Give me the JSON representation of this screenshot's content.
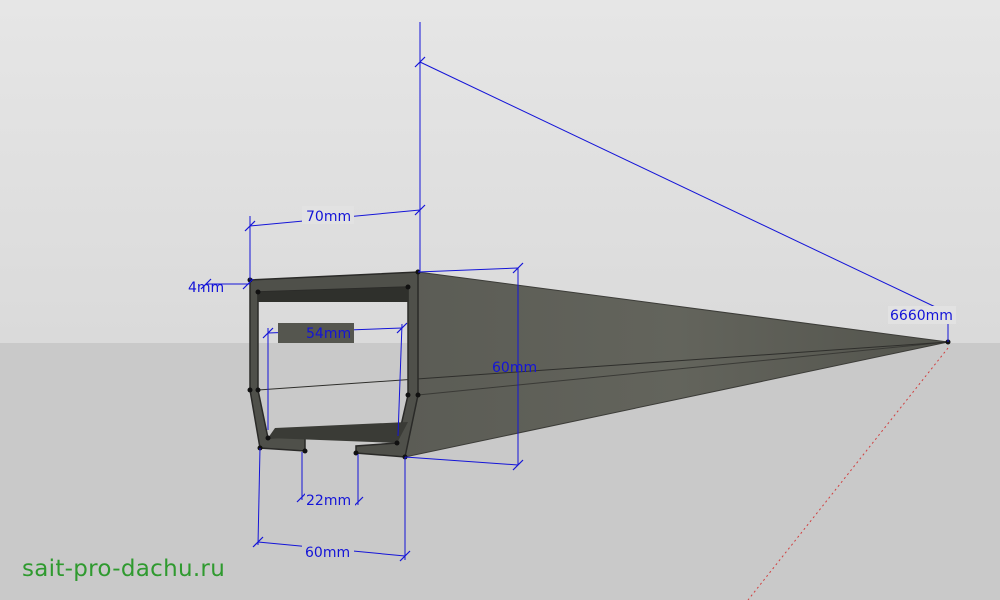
{
  "scene": {
    "sky_color": "#e1e1e1",
    "ground_color": "#c9c9c9",
    "profile_color": "#55564f",
    "dimension_color": "#1414d8"
  },
  "dimensions": {
    "width_top": "70mm",
    "wall_thickness": "4mm",
    "inner_width": "54mm",
    "height": "60mm",
    "slot_width": "22mm",
    "width_bottom": "60mm",
    "length": "6660mm"
  },
  "watermark": "sait-pro-dachu.ru"
}
